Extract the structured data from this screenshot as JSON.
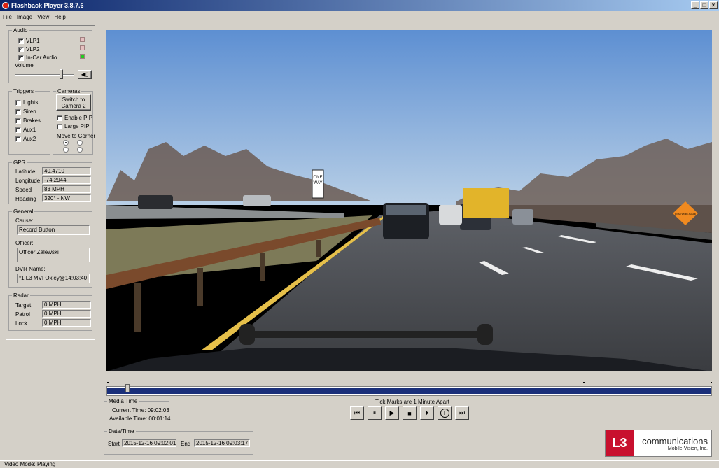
{
  "window": {
    "title": "Flashback Player 3.8.7.6",
    "buttons": [
      "_",
      "□",
      "×"
    ]
  },
  "menu": [
    "File",
    "Image",
    "View",
    "Help"
  ],
  "audio": {
    "legend": "Audio",
    "channels": [
      {
        "label": "VLP1",
        "checked": true,
        "led": "#e6bfbf"
      },
      {
        "label": "VLP2",
        "checked": true,
        "led": "#e6bfbf"
      },
      {
        "label": "In-Car Audio",
        "checked": true,
        "led": "#22cc22"
      }
    ],
    "volume_label": "Volume",
    "volume_level": 0.78
  },
  "triggers": {
    "legend": "Triggers",
    "items": [
      "Lights",
      "Siren",
      "Brakes",
      "Aux1",
      "Aux2"
    ]
  },
  "cameras": {
    "legend": "Cameras",
    "switch_line1": "Switch to",
    "switch_line2": "Camera 2",
    "enable_pip": "Enable PIP",
    "large_pip": "Large PIP",
    "move_corner": "Move to Corner"
  },
  "gps": {
    "legend": "GPS",
    "rows": [
      {
        "label": "Latitude",
        "value": "40.4710"
      },
      {
        "label": "Longitude",
        "value": "-74.2944"
      },
      {
        "label": "Speed",
        "value": "83 MPH"
      },
      {
        "label": "Heading",
        "value": "320° - NW"
      }
    ]
  },
  "general": {
    "legend": "General",
    "cause_label": "Cause:",
    "cause": "Record Button",
    "officer_label": "Officer:",
    "officer": "Officer Zalewski",
    "dvr_label": "DVR Name:",
    "dvr": "*1 L3 MVI Oxley@14:03:40"
  },
  "radar": {
    "legend": "Radar",
    "rows": [
      {
        "label": "Target",
        "value": "0 MPH"
      },
      {
        "label": "Patrol",
        "value": "0 MPH"
      },
      {
        "label": "Lock",
        "value": "0 MPH"
      }
    ]
  },
  "video": {
    "sign_one": "ONE",
    "sign_way": "WAY",
    "sign_road": "ROAD WORK AHEAD"
  },
  "timeline": {
    "progress": 0.03
  },
  "media_time": {
    "legend": "Media Time",
    "current": "Current Time: 09:02:03",
    "available": "Available Time: 00:01:14"
  },
  "controls": {
    "tick_note": "Tick Marks are 1 Minute Apart",
    "buttons": [
      "⏮",
      "⏸",
      "▶",
      "■",
      "⏵",
      "T",
      "⏭"
    ]
  },
  "datetime": {
    "legend": "Date/Time",
    "start_label": "Start",
    "start": "2015-12-16 09:02:01",
    "end_label": "End",
    "end": "2015-12-16 09:03:17"
  },
  "logo": {
    "mark": "L3",
    "line1": "communications",
    "line2": "Mobile-Vision, Inc."
  },
  "status": "Video Mode: Playing"
}
